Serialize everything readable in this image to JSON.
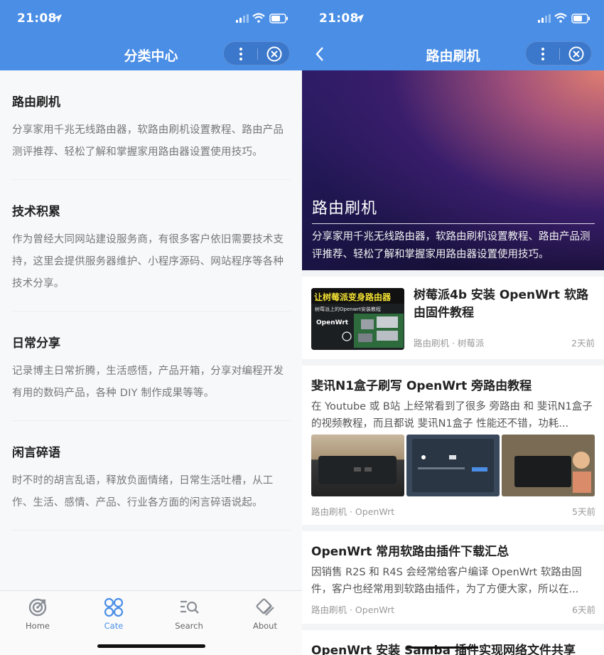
{
  "status": {
    "time": "21:08"
  },
  "left": {
    "nav_title": "分类中心",
    "categories": [
      {
        "title": "路由刷机",
        "desc": "分享家用千兆无线路由器，软路由刷机设置教程、路由产品测评推荐、轻松了解和掌握家用路由器设置使用技巧。"
      },
      {
        "title": "技术积累",
        "desc": "作为曾经大同网站建设服务商，有很多客户依旧需要技术支持，这里会提供服务器维护、小程序源码、网站程序等各种技术分享。"
      },
      {
        "title": "日常分享",
        "desc": "记录博主日常折腾，生活感悟，产品开箱，分享对编程开发有用的数码产品，各种 DIY 制作成果等等。"
      },
      {
        "title": "闲言碎语",
        "desc": "时不时的胡言乱语，释放负面情绪，日常生活吐槽，从工作、生活、感情、产品、行业各方面的闲言碎语说起。"
      }
    ],
    "tabs": [
      {
        "label": "Home",
        "icon": "target-icon",
        "active": false
      },
      {
        "label": "Cate",
        "icon": "grid-icon",
        "active": true
      },
      {
        "label": "Search",
        "icon": "search-icon",
        "active": false
      },
      {
        "label": "About",
        "icon": "about-icon",
        "active": false
      }
    ]
  },
  "right": {
    "nav_title": "路由刷机",
    "hero": {
      "title": "路由刷机",
      "desc": "分享家用千兆无线路由器，软路由刷机设置教程、路由产品测评推荐、轻松了解和掌握家用路由器设置使用技巧。"
    },
    "articles": [
      {
        "title": "树莓派4b 安装 OpenWrt 软路由固件教程",
        "thumb_title": "让树莓派变身路由器",
        "thumb_sub": "树莓派上的Openwrt安装教程",
        "thumb_brand": "OpenWrt",
        "meta": "路由刷机 · 树莓派",
        "ago": "2天前"
      },
      {
        "title": "斐讯N1盒子刷写 OpenWrt 旁路由教程",
        "excerpt": "在 Youtube 或 B站 上经常看到了很多 旁路由 和 斐讯N1盒子 的视频教程，而且都说 斐讯N1盒子 性能还不错，功耗...",
        "meta": "路由刷机 · OpenWrt",
        "ago": "5天前"
      },
      {
        "title": "OpenWrt 常用软路由插件下载汇总",
        "excerpt": "因销售 R2S 和 R4S 会经常给客户编译 OpenWrt 软路由固件，客户也经常用到软路由插件，为了方便大家，所以在...",
        "meta": "路由刷机 · OpenWrt",
        "ago": "6天前"
      },
      {
        "title": "OpenWrt 安装 Samba 插件实现网络文件共享"
      }
    ]
  },
  "colors": {
    "accent": "#4a8ee6"
  }
}
